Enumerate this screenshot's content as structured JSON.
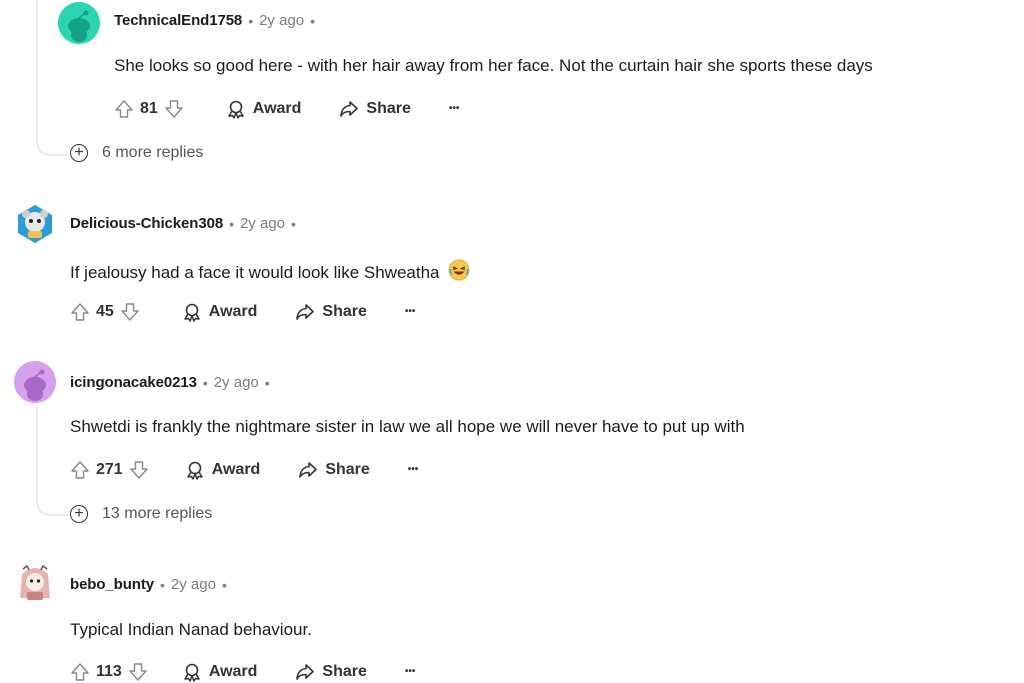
{
  "comments": [
    {
      "username": "TechnicalEnd1758",
      "age": "2y ago",
      "text": "She looks so good here - with her hair away from her face. Not the curtain hair she sports these days",
      "votes": "81",
      "award_label": "Award",
      "share_label": "Share",
      "more_label": "•••",
      "avatar_color": "#2ad6b2"
    },
    {
      "username": "Delicious-Chicken308",
      "age": "2y ago",
      "text": "If jealousy had a face it would look like Shweatha",
      "emoji": "laughing-emoji",
      "votes": "45",
      "award_label": "Award",
      "share_label": "Share",
      "more_label": "•••",
      "avatar_color": "#2a9ed6"
    },
    {
      "username": "icingonacake0213",
      "age": "2y ago",
      "text": "Shwetdi is frankly the nightmare sister in law we all hope we will never have to put up with",
      "votes": "271",
      "award_label": "Award",
      "share_label": "Share",
      "more_label": "•••",
      "avatar_color": "#d6a0ec"
    },
    {
      "username": "bebo_bunty",
      "age": "2y ago",
      "text": "Typical Indian Nanad behaviour.",
      "votes": "113",
      "award_label": "Award",
      "share_label": "Share",
      "more_label": "•••",
      "avatar_color": "#f4d8d0"
    }
  ],
  "more_replies": [
    {
      "label": "6 more replies"
    },
    {
      "label": "13 more replies"
    }
  ],
  "dot_separator": "•"
}
